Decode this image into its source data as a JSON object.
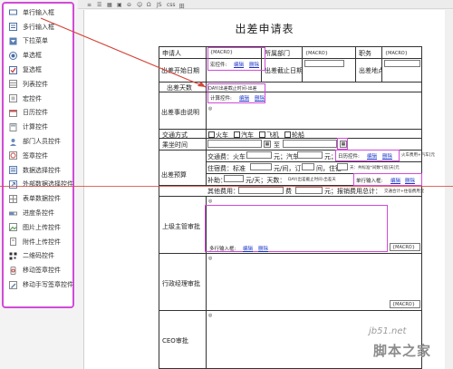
{
  "palette": {
    "items": [
      {
        "label": "单行输入框",
        "icon": "single-line-input-icon"
      },
      {
        "label": "多行输入框",
        "icon": "multi-line-input-icon"
      },
      {
        "label": "下拉菜单",
        "icon": "dropdown-icon"
      },
      {
        "label": "单选框",
        "icon": "radio-icon"
      },
      {
        "label": "复选框",
        "icon": "checkbox-icon"
      },
      {
        "label": "列表控件",
        "icon": "list-icon"
      },
      {
        "label": "宏控件",
        "icon": "macro-icon"
      },
      {
        "label": "日历控件",
        "icon": "calendar-icon"
      },
      {
        "label": "计算控件",
        "icon": "calculator-icon"
      },
      {
        "label": "部门人员控件",
        "icon": "people-icon"
      },
      {
        "label": "签章控件",
        "icon": "seal-icon"
      },
      {
        "label": "数据选择控件",
        "icon": "data-select-icon"
      },
      {
        "label": "外部数据选择控件",
        "icon": "external-data-icon"
      },
      {
        "label": "表单数据控件",
        "icon": "form-data-icon"
      },
      {
        "label": "进度条控件",
        "icon": "progress-icon"
      },
      {
        "label": "图片上传控件",
        "icon": "image-upload-icon"
      },
      {
        "label": "附件上传控件",
        "icon": "attachment-icon"
      },
      {
        "label": "二维码控件",
        "icon": "qrcode-icon"
      },
      {
        "label": "移动签章控件",
        "icon": "mobile-seal-icon"
      },
      {
        "label": "移动手写签章控件",
        "icon": "handwrite-seal-icon"
      }
    ]
  },
  "toolbar": {
    "symbols": [
      "Ω",
      "JS",
      "css",
      "田"
    ]
  },
  "form": {
    "title": "出差申请表",
    "applicant_label": "申请人",
    "dept_label": "所属部门",
    "post_label": "职务",
    "macro": "{MACRO}",
    "macro_ctrl": "宏控件:",
    "edit": "编辑",
    "delete": "删除",
    "start_label": "出差开始日期",
    "end_label": "出差截止日期",
    "place_label": "出差地点",
    "days_label": "出差天数",
    "days_formula": "DAY(出差截止时间-出差",
    "calc_ctrl": "计算控件:",
    "reason_label": "出差事由说明",
    "transport_label": "交通方式",
    "transport_opts": [
      "火车",
      "汽车",
      "飞机",
      "轮船"
    ],
    "ticket_label": "乘坐时间",
    "to_text": "至",
    "budget_label": "出差预算",
    "traffic_fee": "交通费：火车",
    "bus_fee": "元；汽车",
    "yuan": "元；",
    "calendar_ctrl": "日历控件:",
    "train_fee_formula": "火车费用+汽车[元",
    "lodging": "住宿费：标准",
    "per_day": "元/间，订",
    "room_text": "间，住宿",
    "days_formula2": "天：共标准*间数*[宿]天[元",
    "allowance": "补助：",
    "allowance_rate": "元/天；天数：",
    "days_formula3": "DAY(出差截止时间-出差天",
    "single_ctrl": "单行输入框:",
    "other_fee": "其他费用：",
    "fee_text": "费",
    "total_text": "元；报销费用总计：",
    "total_formula": "交通合计+住宿费用元",
    "leader_label": "上级主管审批",
    "multi_ctrl": "多行输入框:",
    "admin_label": "行政经理审批",
    "ceo_label": "CEO审批"
  },
  "watermark": {
    "site": "jb51.net",
    "brand": "脚本之家"
  },
  "colors": {
    "highlight": "#d24bd7",
    "arrow": "#d4453a",
    "link": "#1a35c9"
  }
}
